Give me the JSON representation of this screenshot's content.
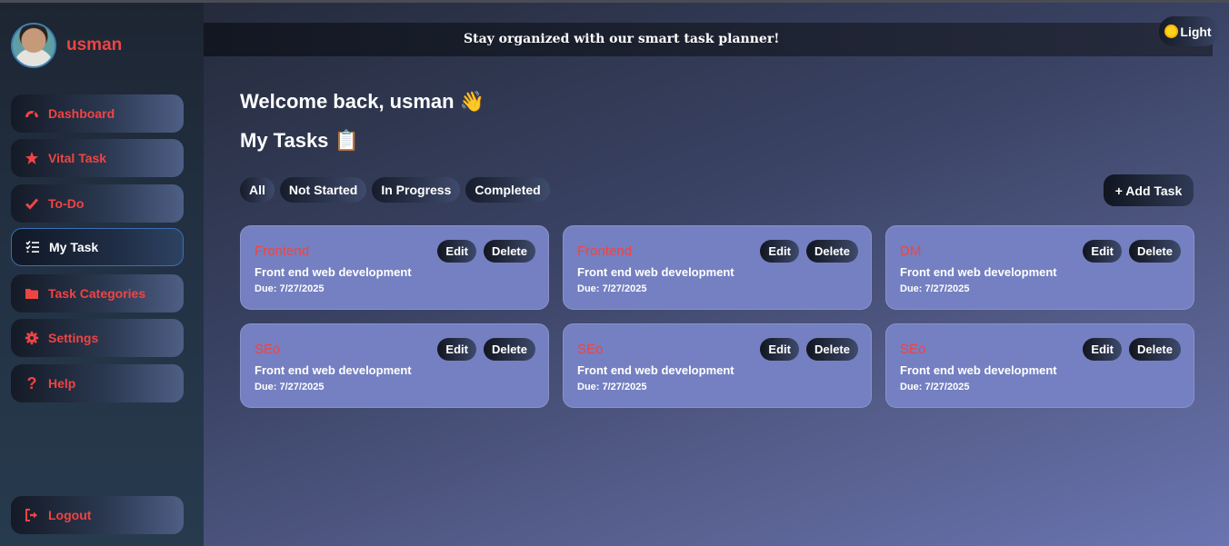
{
  "user": {
    "name": "usman"
  },
  "sidebar": {
    "items": [
      {
        "label": "Dashboard",
        "icon": "gauge-icon"
      },
      {
        "label": "Vital Task",
        "icon": "star-icon"
      },
      {
        "label": "To-Do",
        "icon": "check-icon"
      },
      {
        "label": "My Task",
        "icon": "list-check-icon",
        "active": true
      },
      {
        "label": "Task Categories",
        "icon": "folder-icon"
      },
      {
        "label": "Settings",
        "icon": "gear-icon"
      },
      {
        "label": "Help",
        "icon": "question-icon"
      }
    ],
    "logout": "Logout"
  },
  "header": {
    "banner": "Stay organized with our smart task planner!",
    "theme_label": "Light"
  },
  "main": {
    "welcome": "Welcome back, usman 👋",
    "title": "My Tasks 📋",
    "filters": [
      "All",
      "Not Started",
      "In Progress",
      "Completed"
    ],
    "add_task": "+ Add Task",
    "cards": [
      {
        "category": "Frontend",
        "description": "Front end web development",
        "due": "Due: 7/27/2025"
      },
      {
        "category": "Frontend",
        "description": "Front end web development",
        "due": "Due: 7/27/2025"
      },
      {
        "category": "DM",
        "description": "Front end web development",
        "due": "Due: 7/27/2025"
      },
      {
        "category": "SEo",
        "description": "Front end web development",
        "due": "Due: 7/27/2025"
      },
      {
        "category": "SEo",
        "description": "Front end web development",
        "due": "Due: 7/27/2025"
      },
      {
        "category": "SEo",
        "description": "Front end web development",
        "due": "Due: 7/27/2025"
      }
    ],
    "edit_label": "Edit",
    "delete_label": "Delete"
  },
  "colors": {
    "accent_red": "#ef4444",
    "card_bg": "#7480c1",
    "active_border": "#3b6fb3"
  }
}
